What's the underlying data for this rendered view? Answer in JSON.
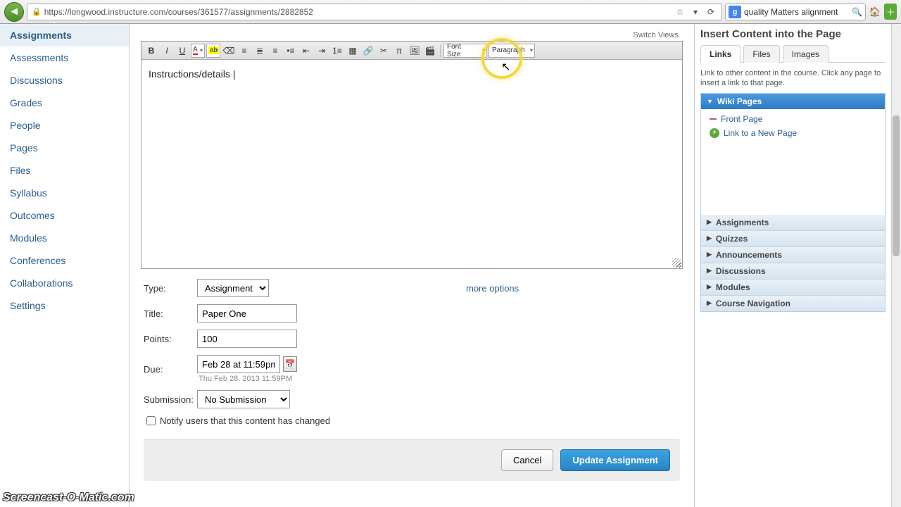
{
  "browser": {
    "url": "https://longwood.instructure.com/courses/361577/assignments/2882852",
    "search": "quality Matters alignment"
  },
  "nav": {
    "items": [
      "Assignments",
      "Assessments",
      "Discussions",
      "Grades",
      "People",
      "Pages",
      "Files",
      "Syllabus",
      "Outcomes",
      "Modules",
      "Conferences",
      "Collaborations",
      "Settings"
    ],
    "active": "Assignments"
  },
  "editor": {
    "switch_views": "Switch Views",
    "content": "Instructions/details |",
    "font_size_label": "Font Size",
    "paragraph_label": "Paragraph"
  },
  "form": {
    "type_label": "Type:",
    "type_value": "Assignment",
    "title_label": "Title:",
    "title_value": "Paper One",
    "points_label": "Points:",
    "points_value": "100",
    "due_label": "Due:",
    "due_value": "Feb 28 at 11:59pm",
    "due_hint": "Thu Feb 28, 2013 11:59PM",
    "submission_label": "Submission:",
    "submission_value": "No Submission",
    "more_options": "more options",
    "notify_label": "Notify users that this content has changed",
    "cancel": "Cancel",
    "update": "Update Assignment"
  },
  "right": {
    "title": "Insert Content into the Page",
    "tabs": [
      "Links",
      "Files",
      "Images"
    ],
    "active_tab": "Links",
    "hint": "Link to other content in the course. Click any page to insert a link to that page.",
    "wiki_header": "Wiki Pages",
    "front_page": "Front Page",
    "new_page": "Link to a New Page",
    "sections": [
      "Assignments",
      "Quizzes",
      "Announcements",
      "Discussions",
      "Modules",
      "Course Navigation"
    ]
  },
  "watermark": "Screencast-O-Matic.com"
}
